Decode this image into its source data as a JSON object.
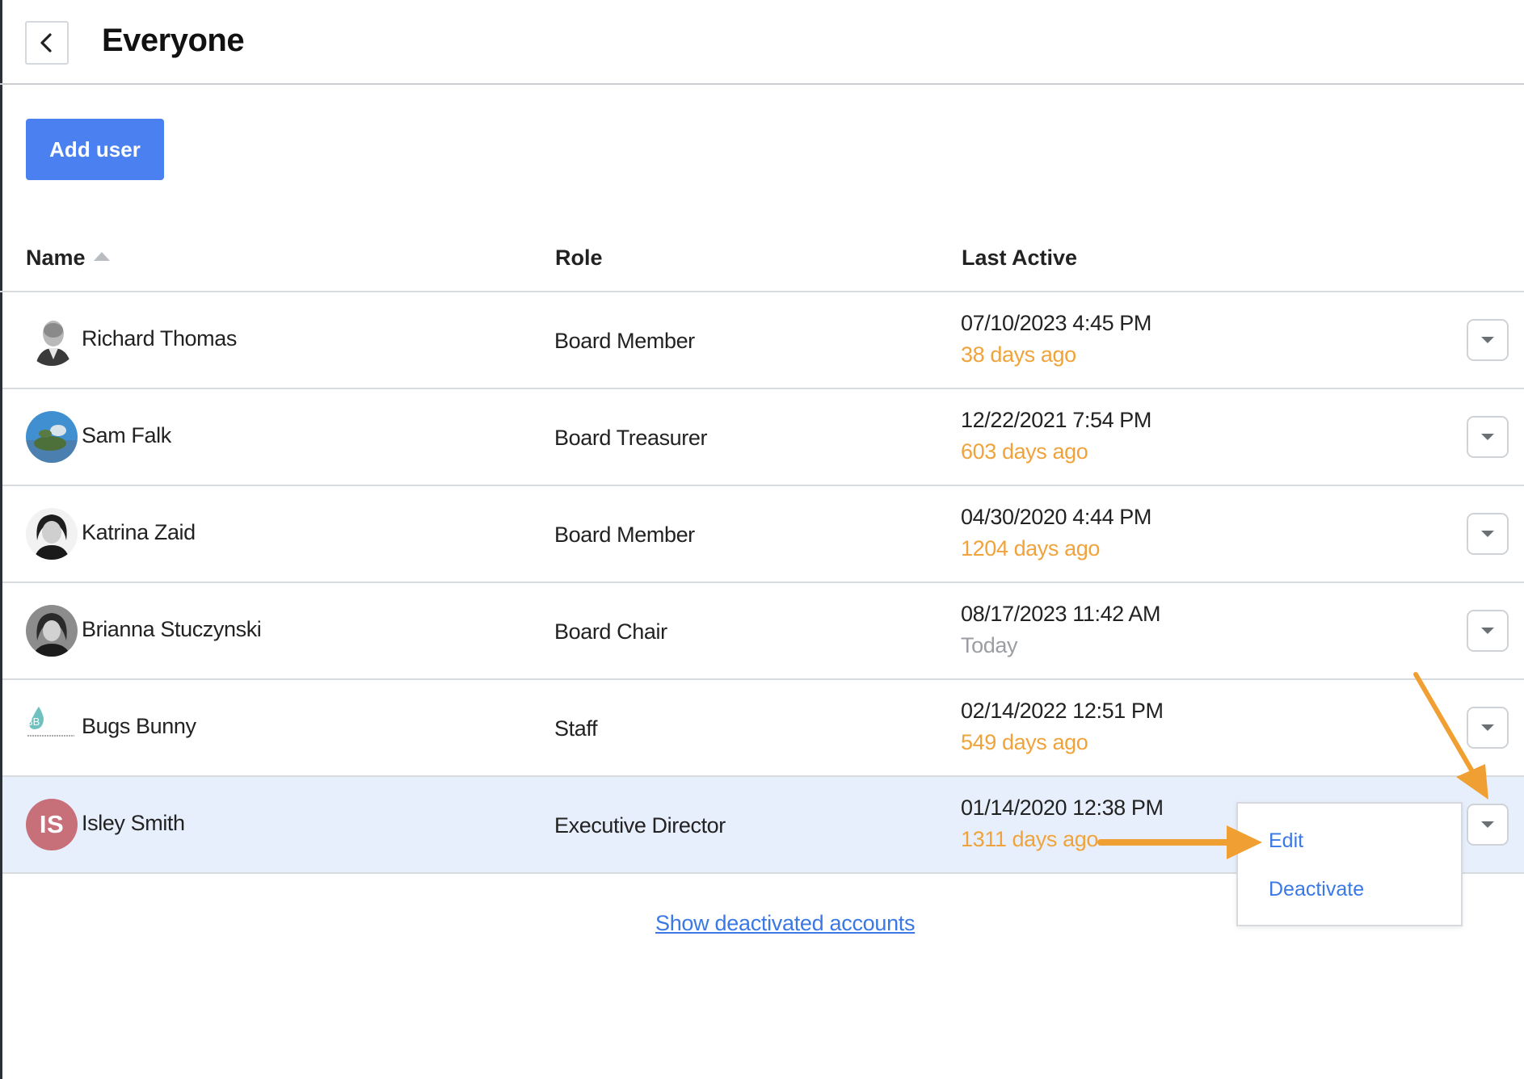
{
  "header": {
    "title": "Everyone"
  },
  "toolbar": {
    "add_user_label": "Add user"
  },
  "table": {
    "columns": {
      "name": "Name",
      "role": "Role",
      "last_active": "Last Active"
    },
    "rows": [
      {
        "name": "Richard Thomas",
        "role": "Board Member",
        "date": "07/10/2023 4:45 PM",
        "ago": "38 days ago"
      },
      {
        "name": "Sam Falk",
        "role": "Board Treasurer",
        "date": "12/22/2021 7:54 PM",
        "ago": "603 days ago"
      },
      {
        "name": "Katrina Zaid",
        "role": "Board Member",
        "date": "04/30/2020 4:44 PM",
        "ago": "1204 days ago"
      },
      {
        "name": "Brianna Stuczynski",
        "role": "Board Chair",
        "date": "08/17/2023 11:42 AM",
        "ago": "Today"
      },
      {
        "name": "Bugs Bunny",
        "role": "Staff",
        "date": "02/14/2022 12:51 PM",
        "ago": "549 days ago",
        "avatar_text": "BB"
      },
      {
        "name": "Isley Smith",
        "role": "Executive Director",
        "date": "01/14/2020 12:38 PM",
        "ago": "1311 days ago",
        "avatar_text": "IS"
      }
    ]
  },
  "menu": {
    "edit": "Edit",
    "deactivate": "Deactivate"
  },
  "footer": {
    "show_deactivated": "Show deactivated accounts"
  },
  "colors": {
    "accent": "#4a80f0",
    "link": "#3a78e6",
    "ago": "#f0a33a",
    "annotation": "#f0a033",
    "selected_row": "#e8effc"
  }
}
